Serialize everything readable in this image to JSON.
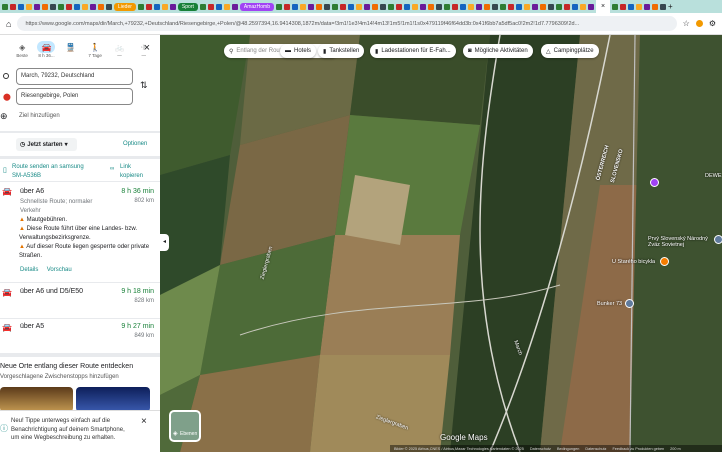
{
  "browser": {
    "bookmarks": [
      {
        "label": "Lieder",
        "color": "#f29900"
      },
      {
        "label": "Sport",
        "color": "#188038"
      },
      {
        "label": "AmazHomb",
        "color": "#a142f4"
      }
    ],
    "url": "https://www.google.com/maps/dir/March,+79232,+Deutschland/Riesengebirge,+Polen/@48.2597394,16.9414308,1872m/data=!3m1!1e3!4m14!4m13!1m5!1m1!1s0x479119f46f64dd3b:0x41f6bb7a5df5ac0!2m2!1d7.7796309!2d...",
    "tab_close": "×",
    "new_tab": "+"
  },
  "sidebar": {
    "modes": [
      {
        "label": "Beste",
        "icon": "◈"
      },
      {
        "label": "8 h 36...",
        "icon": "🚘"
      },
      {
        "label": "",
        "icon": "🚆"
      },
      {
        "label": "7 Tage",
        "icon": "🚶"
      },
      {
        "label": "—",
        "icon": "🚲"
      },
      {
        "label": "—",
        "icon": "✈"
      }
    ],
    "close": "×",
    "origin": "March, 79232, Deutschland",
    "destination": "Riesengebirge, Polen",
    "add_stop": "Ziel hinzufügen",
    "depart": "Jetzt starten",
    "options": "Optionen",
    "send_to": "Route senden an samsung SM-A536B",
    "copy_link": "Link kopieren",
    "routes": [
      {
        "name": "über A6",
        "time": "8 h 36 min",
        "distance": "802 km",
        "desc": "Schnellste Route; normaler Verkehr",
        "warnings": [
          "Mautgebühren.",
          "Diese Route führt über eine Landes- bzw. Verwaltungsbezirksgrenze.",
          "Auf dieser Route liegen gesperrte oder private Straßen."
        ],
        "details": "Details",
        "preview": "Vorschau"
      },
      {
        "name": "über A6 und D5/E50",
        "time": "9 h 18 min",
        "distance": "828 km"
      },
      {
        "name": "über A5",
        "time": "9 h 27 min",
        "distance": "849 km"
      }
    ],
    "discover_title": "Neue Orte entlang dieser Route entdecken",
    "discover_sub": "Vorgeschlagene Zwischenstopps hinzufügen",
    "notice": "Neu! Tippe unterwegs einfach auf die Benachrichtigung auf deinem Smartphone, um eine Wegbeschreibung zu erhalten."
  },
  "map": {
    "search_placeholder": "Entlang der Route suche...",
    "filters": [
      "Hotels",
      "Tankstellen",
      "Ladestationen für E-Fah...",
      "Mögliche Aktivitäten",
      "Campingplätze"
    ],
    "labels": {
      "border1": "ÖSTERREICH",
      "border2": "SLOVENSKO",
      "road1": "Zieglergraben",
      "road2": "March",
      "road3": "Zieglergraben",
      "dewe": "DEWE",
      "place1": "Prvý Slovenský Národný Zväz Sovietnej",
      "place2": "U Starého bicykla",
      "place3": "Bunker 73"
    },
    "layers": "Ebenen",
    "logo": "Google Maps",
    "footer": [
      "Bilder © 2025 Airbus,CNES / Airbus,Maxar Technologies,Kartendaten © 2025",
      "Datenschutz",
      "Bedingungen",
      "Datenschutz",
      "Feedback zu Produkten geben",
      "200 m"
    ]
  }
}
